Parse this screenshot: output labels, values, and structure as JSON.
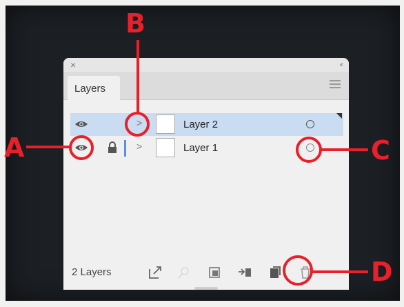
{
  "panel": {
    "close_icon": "×",
    "collapse_icon": "‹‹",
    "tab_label": "Layers",
    "menu_icon": "hamburger-menu-icon"
  },
  "layers": [
    {
      "name": "Layer 2",
      "selected": true,
      "locked": false,
      "visible": true
    },
    {
      "name": "Layer 1",
      "selected": false,
      "locked": true,
      "visible": true
    }
  ],
  "footer": {
    "count_label": "2 Layers",
    "icons": [
      "export-icon",
      "search-icon",
      "clipping-mask-icon",
      "new-sublayer-icon",
      "new-layer-icon",
      "delete-icon"
    ]
  },
  "callouts": {
    "a": "A",
    "b": "B",
    "c": "C",
    "d": "D"
  },
  "colors": {
    "callout_red": "#e8202a",
    "selection_blue": "#c9dcf2",
    "layer_color_bar": "#5d8fe0"
  }
}
